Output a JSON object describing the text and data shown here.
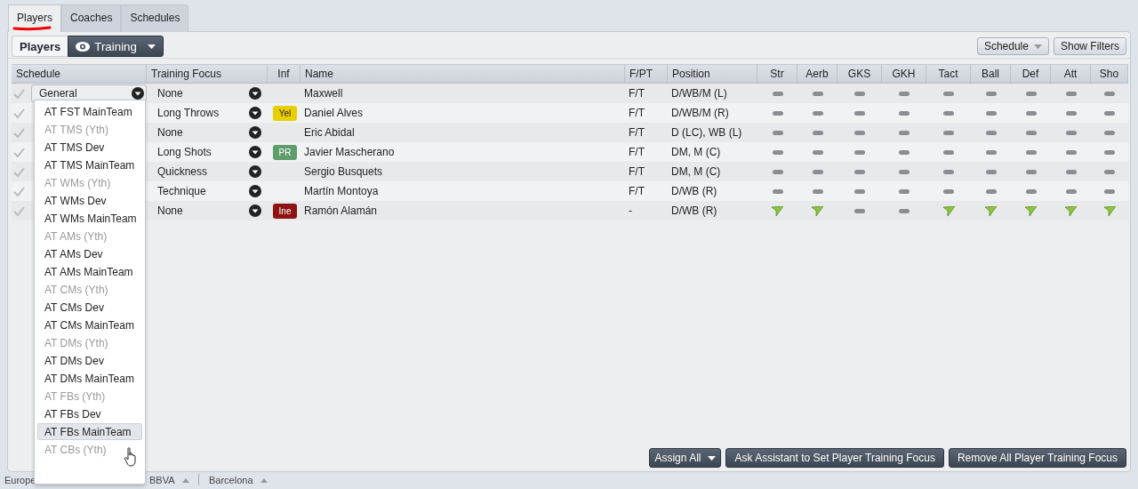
{
  "tabs": [
    {
      "label": "Players",
      "selected": true,
      "underlined": true
    },
    {
      "label": "Coaches",
      "selected": false,
      "underlined": false
    },
    {
      "label": "Schedules",
      "selected": false,
      "underlined": false
    }
  ],
  "toolbar": {
    "title": "Players",
    "view_button": "Training",
    "schedule_button": "Schedule",
    "filters_button": "Show Filters"
  },
  "table": {
    "columns": [
      "Schedule",
      "Training Focus",
      "Inf",
      "Name",
      "F/PT",
      "Position",
      "Str",
      "Aerb",
      "GKS",
      "GKH",
      "Tact",
      "Ball",
      "Def",
      "Att",
      "Sho"
    ],
    "rows": [
      {
        "schedule": "General",
        "focus": "None",
        "inf": null,
        "name": "Maxwell",
        "fpt": "F/T",
        "position": "D/WB/M (L)",
        "ratings": [
          {
            "kind": "dash"
          },
          {
            "kind": "dash"
          },
          {
            "kind": "dash"
          },
          {
            "kind": "dash"
          },
          {
            "kind": "dash"
          },
          {
            "kind": "dash"
          },
          {
            "kind": "dash"
          },
          {
            "kind": "dash"
          },
          {
            "kind": "dash"
          }
        ]
      },
      {
        "focus": "Long Throws",
        "inf": {
          "label": "Yel",
          "color": "#e8d000"
        },
        "name": "Daniel Alves",
        "fpt": "F/T",
        "position": "D/WB/M (R)",
        "ratings": [
          {
            "kind": "dash"
          },
          {
            "kind": "dash"
          },
          {
            "kind": "dash"
          },
          {
            "kind": "dash"
          },
          {
            "kind": "dash"
          },
          {
            "kind": "dash"
          },
          {
            "kind": "dash"
          },
          {
            "kind": "dash"
          },
          {
            "kind": "dash"
          }
        ]
      },
      {
        "focus": "None",
        "inf": null,
        "name": "Eric Abidal",
        "fpt": "F/T",
        "position": "D (LC), WB (L)",
        "ratings": [
          {
            "kind": "dash"
          },
          {
            "kind": "dash"
          },
          {
            "kind": "dash"
          },
          {
            "kind": "dash"
          },
          {
            "kind": "dash"
          },
          {
            "kind": "dash"
          },
          {
            "kind": "dash"
          },
          {
            "kind": "dash"
          },
          {
            "kind": "dash"
          }
        ]
      },
      {
        "focus": "Long Shots",
        "inf": {
          "label": "PR",
          "color": "#5f9e6a"
        },
        "name": "Javier Mascherano",
        "fpt": "F/T",
        "position": "DM, M (C)",
        "ratings": [
          {
            "kind": "dash"
          },
          {
            "kind": "dash"
          },
          {
            "kind": "dash"
          },
          {
            "kind": "dash"
          },
          {
            "kind": "dash"
          },
          {
            "kind": "dash"
          },
          {
            "kind": "dash"
          },
          {
            "kind": "dash"
          },
          {
            "kind": "dash"
          }
        ]
      },
      {
        "focus": "Quickness",
        "inf": null,
        "name": "Sergio Busquets",
        "fpt": "F/T",
        "position": "DM, M (C)",
        "ratings": [
          {
            "kind": "dash"
          },
          {
            "kind": "dash"
          },
          {
            "kind": "dash"
          },
          {
            "kind": "dash"
          },
          {
            "kind": "dash"
          },
          {
            "kind": "dash"
          },
          {
            "kind": "dash"
          },
          {
            "kind": "dash"
          },
          {
            "kind": "dash"
          }
        ]
      },
      {
        "focus": "Technique",
        "inf": null,
        "name": "Martín Montoya",
        "fpt": "F/T",
        "position": "D/WB (R)",
        "ratings": [
          {
            "kind": "dash"
          },
          {
            "kind": "dash"
          },
          {
            "kind": "dash"
          },
          {
            "kind": "dash"
          },
          {
            "kind": "dash"
          },
          {
            "kind": "dash"
          },
          {
            "kind": "dash"
          },
          {
            "kind": "dash"
          },
          {
            "kind": "dash"
          }
        ]
      },
      {
        "focus": "None",
        "inf": {
          "label": "Ine",
          "color": "#8e1414"
        },
        "name": "Ramón Alamán",
        "fpt": "-",
        "position": "D/WB (R)",
        "ratings": [
          {
            "kind": "arrow"
          },
          {
            "kind": "arrow"
          },
          {
            "kind": "dash"
          },
          {
            "kind": "dash"
          },
          {
            "kind": "arrow"
          },
          {
            "kind": "arrow"
          },
          {
            "kind": "arrow"
          },
          {
            "kind": "arrow"
          },
          {
            "kind": "arrow"
          }
        ]
      }
    ]
  },
  "schedule_menu": [
    {
      "label": "AT FST MainTeam",
      "disabled": false,
      "selected": false
    },
    {
      "label": "AT TMS (Yth)",
      "disabled": true,
      "selected": false
    },
    {
      "label": "AT TMS Dev",
      "disabled": false,
      "selected": false
    },
    {
      "label": "AT TMS MainTeam",
      "disabled": false,
      "selected": false
    },
    {
      "label": "AT WMs (Yth)",
      "disabled": true,
      "selected": false
    },
    {
      "label": "AT WMs Dev",
      "disabled": false,
      "selected": false
    },
    {
      "label": "AT WMs MainTeam",
      "disabled": false,
      "selected": false
    },
    {
      "label": "AT AMs (Yth)",
      "disabled": true,
      "selected": false
    },
    {
      "label": "AT AMs Dev",
      "disabled": false,
      "selected": false
    },
    {
      "label": "AT AMs MainTeam",
      "disabled": false,
      "selected": false
    },
    {
      "label": "AT CMs (Yth)",
      "disabled": true,
      "selected": false
    },
    {
      "label": "AT CMs Dev",
      "disabled": false,
      "selected": false
    },
    {
      "label": "AT CMs MainTeam",
      "disabled": false,
      "selected": false
    },
    {
      "label": "AT DMs (Yth)",
      "disabled": true,
      "selected": false
    },
    {
      "label": "AT DMs Dev",
      "disabled": false,
      "selected": false
    },
    {
      "label": "AT DMs MainTeam",
      "disabled": false,
      "selected": false
    },
    {
      "label": "AT FBs (Yth)",
      "disabled": true,
      "selected": false
    },
    {
      "label": "AT FBs Dev",
      "disabled": false,
      "selected": false
    },
    {
      "label": "AT FBs MainTeam",
      "disabled": false,
      "selected": true
    },
    {
      "label": "AT CBs (Yth)",
      "disabled": true,
      "selected": false
    }
  ],
  "footer_buttons": [
    {
      "label": "Assign All",
      "kind": "menu"
    },
    {
      "label": "Ask Assistant to Set Player Training Focus",
      "kind": "plain"
    },
    {
      "label": "Remove All Player Training Focus",
      "kind": "plain"
    }
  ],
  "status_bar": [
    "Europe",
    "BBVA",
    "Barcelona"
  ]
}
